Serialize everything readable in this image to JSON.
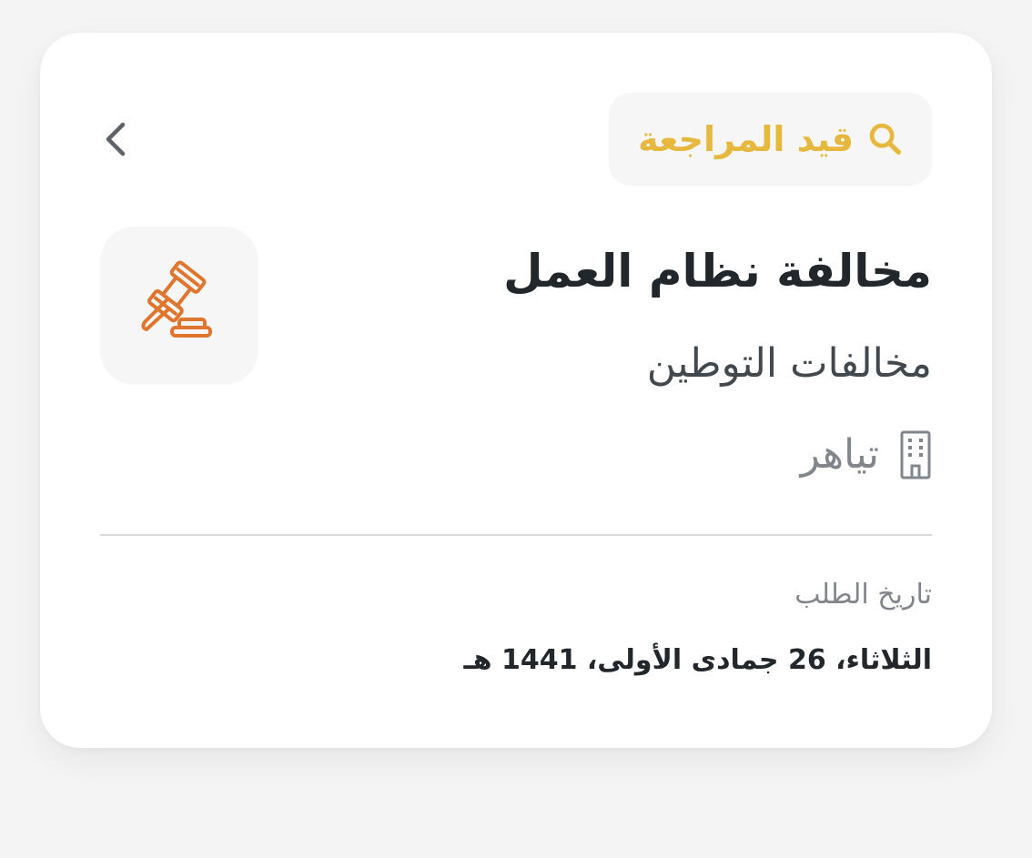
{
  "request": {
    "status": {
      "label": "قيد المراجعة",
      "icon": "search-icon",
      "color": "#e6b83e"
    },
    "back_icon": "chevron-left-icon",
    "category_icon": "gavel-icon",
    "category_icon_color": "#e0762e",
    "title": "مخالفة نظام العمل",
    "subtitle": "مخالفات التوطين",
    "company": {
      "icon": "building-icon",
      "name": "تياهر"
    },
    "date": {
      "label": "تاريخ الطلب",
      "value": "الثلاثاء، 26 جمادى الأولى، 1441 هـ"
    }
  }
}
